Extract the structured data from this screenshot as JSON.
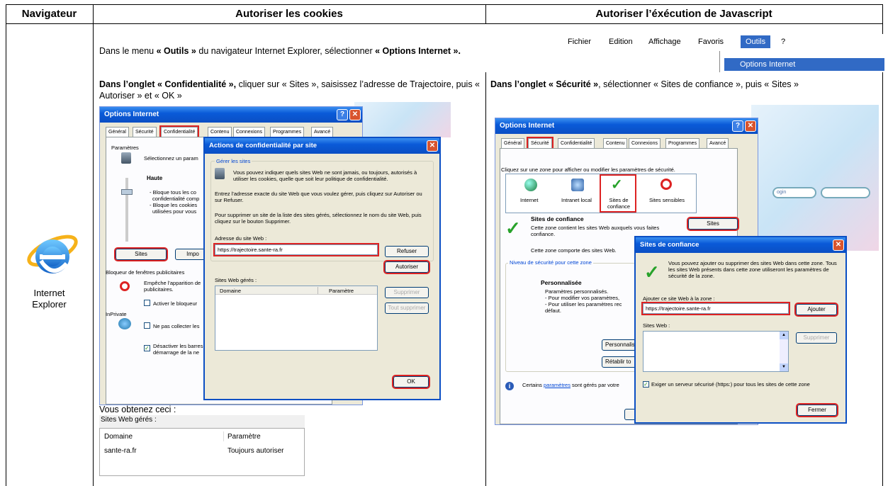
{
  "header": {
    "col1": "Navigateur",
    "col2": "Autoriser les cookies",
    "col3": "Autoriser l’éxécution de Javascript"
  },
  "browser": {
    "line1": "Internet",
    "line2": "Explorer"
  },
  "intro": {
    "pre": "Dans le menu ",
    "outils": "« Outils »",
    "mid": " du navigateur Internet Explorer, sélectionner ",
    "options": "« Options Internet ».",
    "menu_items": [
      "Fichier",
      "Edition",
      "Affichage",
      "Favoris",
      "Outils",
      "?"
    ],
    "menu_dropdown": "Options Internet"
  },
  "cookies": {
    "instr_bold": "Dans l’onglet « Confidentialité »,",
    "instr_rest": " cliquer sur « Sites », saisissez l’adresse de Trajectoire, puis « Autoriser » et « OK »",
    "win_title": "Options Internet",
    "tabs": [
      "Général",
      "Sécurité",
      "Confidentialité",
      "Contenu",
      "Connexions",
      "Programmes",
      "Avancé"
    ],
    "params_label": "Paramètres",
    "select_zone": "Sélectionnez un param",
    "level": "Haute",
    "level_desc1": "- Bloque tous les co",
    "level_desc2": "confidentialité comp",
    "level_desc3": "- Bloque les cookies",
    "level_desc4": "utilisées pour vous",
    "sites_btn": "Sites",
    "import_btn": "Impo",
    "popup_blocker": "Bloqueur de fenêtres publicitaires",
    "popup_prevent1": "Empêche l'apparition de",
    "popup_prevent2": "publicitaires.",
    "activate_blocker": "Activer le bloqueur",
    "inprivate": "InPrivate",
    "no_collect": "Ne pas collecter les",
    "disable_bars1": "Désactiver les barres",
    "disable_bars2": "démarrage de la ne",
    "dialog_title": "Actions de confidentialité par site",
    "manage_sites": "Gérer les sites",
    "dialog_p1": "Vous pouvez indiquer quels sites Web ne sont jamais, ou toujours, autorisés à utiliser les cookies, quelle que soit leur politique de confidentialité.",
    "dialog_p2": "Entrez l'adresse exacte du site Web que vous voulez gérer, puis cliquez sur Autoriser ou sur Refuser.",
    "dialog_p3": "Pour supprimer un site de la liste des sites gérés, sélectionnez le nom du site Web, puis cliquez sur le bouton Supprimer.",
    "address_label": "Adresse du site Web :",
    "address_value": "https://trajectoire.sante-ra.fr",
    "refuse_btn": "Refuser",
    "allow_btn": "Autoriser",
    "managed_label": "Sites Web gérés :",
    "col_domain": "Domaine",
    "col_param": "Paramètre",
    "remove_btn": "Supprimer",
    "remove_all_btn": "Tout supprimer",
    "ok_btn": "OK",
    "result_label": "Vous obtenez ceci :",
    "result_title": "Sites Web gérés :",
    "result_col1": "Domaine",
    "result_col2": "Paramètre",
    "result_domain": "sante-ra.fr",
    "result_param": "Toujours autoriser"
  },
  "javascript": {
    "instr_bold": "Dans l’onglet « Sécurité »",
    "instr_rest": ", sélectionner « Sites de confiance », puis « Sites »",
    "win_title": "Options Internet",
    "tabs": [
      "Général",
      "Sécurité",
      "Confidentialité",
      "Contenu",
      "Connexions",
      "Programmes",
      "Avancé"
    ],
    "zone_instr": "Cliquez sur une zone pour afficher ou modifier les paramètres de sécurité.",
    "zones": [
      "Internet",
      "Intranet local",
      "Sites de confiance",
      "Sites sensibles"
    ],
    "trusted_title": "Sites de confiance",
    "trusted_desc1": "Cette zone contient les sites Web auxquels vous faites confiance.",
    "trusted_desc2": "Cette zone comporte des sites Web.",
    "sites_btn": "Sites",
    "security_level": "Niveau de sécurité pour cette zone",
    "custom": "Personnalisée",
    "custom_d1": "Paramètres personnalisés.",
    "custom_d2": "- Pour modifier vos paramètres,",
    "custom_d3": "- Pour utiliser les paramètres rec",
    "custom_d4": "défaut.",
    "personalize_btn": "Personnalis",
    "restore_btn": "Rétablir to",
    "footer_text_pre": "Certains ",
    "footer_link": "paramètres",
    "footer_text_post": " sont gérés par votre",
    "dialog_title": "Sites de confiance",
    "dialog_desc": "Vous pouvez ajouter ou supprimer des sites Web dans cette zone. Tous les sites Web présents dans cette zone utiliseront les paramètres de sécurité de la zone.",
    "add_label": "Ajouter ce site Web à la zone :",
    "add_value": "https://trajectoire.sante-ra.fr",
    "add_btn": "Ajouter",
    "websites_label": "Sites Web :",
    "remove_btn": "Supprimer",
    "require_https": "Exiger un serveur sécurisé (https:) pour tous les sites de cette zone",
    "close_btn": "Fermer",
    "bg_login": "ogin"
  }
}
